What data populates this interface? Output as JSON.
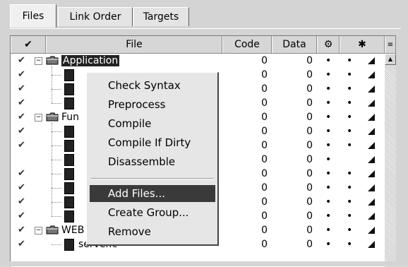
{
  "tabs": [
    {
      "label": "Files",
      "active": true
    },
    {
      "label": "Link Order",
      "active": false
    },
    {
      "label": "Targets",
      "active": false
    }
  ],
  "columns": {
    "check_icon": "check-icon",
    "file": "File",
    "code": "Code",
    "data": "Data",
    "debug_icon": "debug-icon",
    "target_icon": "target-icon",
    "sort_icon": "sort-icon"
  },
  "rows": [
    {
      "kind": "group",
      "name": "Application",
      "selected": true,
      "code": "0",
      "data": "0",
      "dot1": "•",
      "dot2": "•",
      "checked": true
    },
    {
      "kind": "file",
      "name": "",
      "code": "0",
      "data": "0",
      "dot1": "•",
      "dot2": "•",
      "checked": true
    },
    {
      "kind": "file",
      "name": "",
      "code": "0",
      "data": "0",
      "dot1": "•",
      "dot2": "•",
      "checked": true
    },
    {
      "kind": "file",
      "name": "",
      "code": "0",
      "data": "0",
      "dot1": "•",
      "dot2": "•",
      "checked": true
    },
    {
      "kind": "group",
      "name": "Fun",
      "code": "0",
      "data": "0",
      "dot1": "•",
      "dot2": "•",
      "checked": true
    },
    {
      "kind": "file",
      "name": "",
      "code": "0",
      "data": "0",
      "dot1": "•",
      "dot2": "•",
      "checked": true
    },
    {
      "kind": "file",
      "name": "",
      "code": "0",
      "data": "0",
      "dot1": "•",
      "dot2": "•",
      "checked": true
    },
    {
      "kind": "file",
      "name": "",
      "code": "0",
      "data": "0",
      "dot1": "•",
      "dot2": "",
      "checked": false
    },
    {
      "kind": "file",
      "name": "",
      "code": "0",
      "data": "0",
      "dot1": "•",
      "dot2": "•",
      "checked": true
    },
    {
      "kind": "file",
      "name": "",
      "code": "0",
      "data": "0",
      "dot1": "•",
      "dot2": "•",
      "checked": true
    },
    {
      "kind": "file",
      "name": "",
      "code": "0",
      "data": "0",
      "dot1": "•",
      "dot2": "•",
      "checked": true
    },
    {
      "kind": "file",
      "name": "",
      "code": "0",
      "data": "0",
      "dot1": "•",
      "dot2": "•",
      "checked": true
    },
    {
      "kind": "group",
      "name": "WEB",
      "code": "0",
      "data": "0",
      "dot1": "•",
      "dot2": "•",
      "checked": true
    },
    {
      "kind": "file",
      "name": "server.c",
      "code": "0",
      "data": "0",
      "dot1": "•",
      "dot2": "•",
      "checked": true
    }
  ],
  "context_menu": {
    "items": [
      {
        "label": "Check Syntax"
      },
      {
        "label": "Preprocess"
      },
      {
        "label": "Compile"
      },
      {
        "label": "Compile If Dirty"
      },
      {
        "label": "Disassemble"
      },
      {
        "separator": true
      },
      {
        "label": "Add Files...",
        "highlighted": true
      },
      {
        "label": "Create Group..."
      },
      {
        "label": "Remove"
      }
    ]
  },
  "colors": {
    "selection": "#222222",
    "menu_highlight": "#3a3a3a",
    "panel": "#d4d4d4"
  }
}
